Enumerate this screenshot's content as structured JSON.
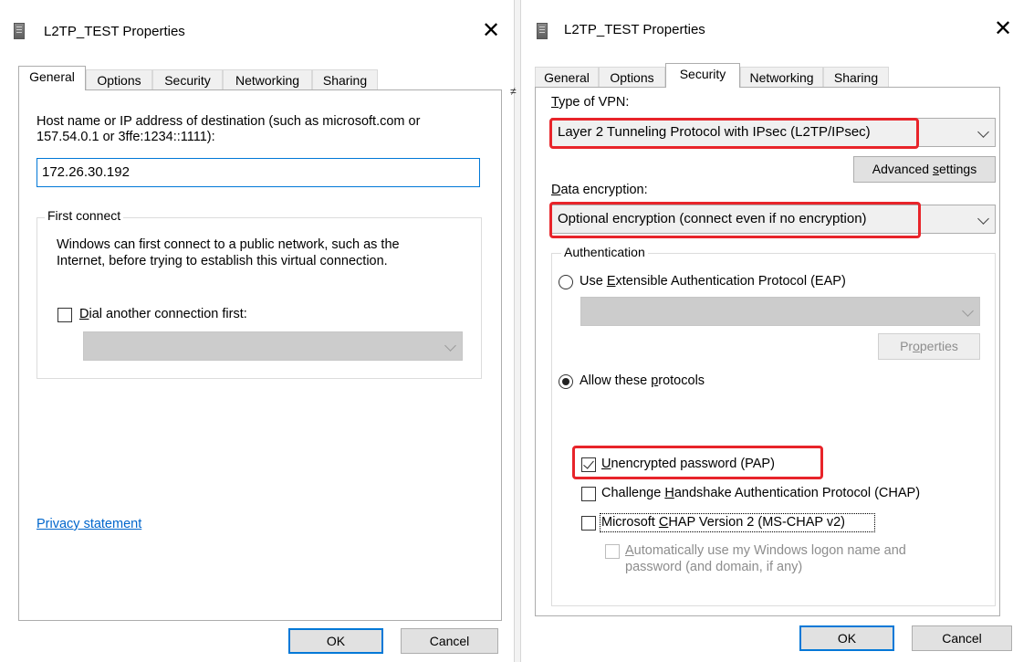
{
  "left_dialog": {
    "title": "L2TP_TEST Properties",
    "close_glyph": "✕",
    "tabs": [
      {
        "label": "General"
      },
      {
        "label": "Options"
      },
      {
        "label": "Security"
      },
      {
        "label": "Networking"
      },
      {
        "label": "Sharing"
      }
    ],
    "active_tab": "General",
    "host_label_line1": "Host name or IP address of destination (such as microsoft.com or",
    "host_label_line2": "157.54.0.1 or 3ffe:1234::1111):",
    "host_value": "172.26.30.192",
    "first_connect": {
      "legend": "First connect",
      "desc_line1": "Windows can first connect to a public network, such as the",
      "desc_line2": "Internet, before trying to establish this virtual connection.",
      "dial_first_d": "D",
      "dial_first_rest": "ial another connection first:",
      "dial_first_checked": false
    },
    "privacy_link": "Privacy statement",
    "ok_label": "OK",
    "cancel_label": "Cancel"
  },
  "right_dialog": {
    "title": "L2TP_TEST Properties",
    "close_glyph": "✕",
    "tabs": [
      {
        "label": "General"
      },
      {
        "label": "Options"
      },
      {
        "label": "Security"
      },
      {
        "label": "Networking"
      },
      {
        "label": "Sharing"
      }
    ],
    "active_tab": "Security",
    "vpn_type_label_u": "T",
    "vpn_type_label_rest": "ype of VPN:",
    "vpn_type_value": "Layer 2 Tunneling Protocol with IPsec (L2TP/IPsec)",
    "advanced_pre": "Advanced ",
    "advanced_u": "s",
    "advanced_post": "ettings",
    "encryption_label_pre": "",
    "encryption_label_u": "D",
    "encryption_label_rest": "ata encryption:",
    "encryption_value": "Optional encryption (connect even if no encryption)",
    "authentication": {
      "legend": "Authentication",
      "eap_pre": "Use ",
      "eap_u": "E",
      "eap_post": "xtensible Authentication Protocol (EAP)",
      "eap_selected": false,
      "properties_pre": "Pr",
      "properties_u": "o",
      "properties_post": "perties",
      "allow_pre": "Allow these ",
      "allow_u": "p",
      "allow_post": "rotocols",
      "allow_selected": true,
      "pap_u": "U",
      "pap_rest": "nencrypted password (PAP)",
      "pap_checked": true,
      "chap_pre": "Challenge ",
      "chap_u": "H",
      "chap_post": "andshake Authentication Protocol (CHAP)",
      "chap_checked": false,
      "mschap_pre": "Microsoft ",
      "mschap_u": "C",
      "mschap_post": "HAP Version 2 (MS-CHAP v2)",
      "mschap_checked": false,
      "auto_u": "A",
      "auto_rest_line1": "utomatically use my Windows logon name and",
      "auto_line2": "password (and domain, if any)",
      "auto_checked": false
    },
    "ok_label": "OK",
    "cancel_label": "Cancel"
  },
  "colors": {
    "highlight_red": "#e8242a",
    "focus_blue": "#0078d7",
    "link_blue": "#0066cc"
  },
  "icons": {
    "title_icon": "vpn-connection-icon",
    "close_icon": "close-icon",
    "dropdown_icon": "chevron-down-icon"
  }
}
